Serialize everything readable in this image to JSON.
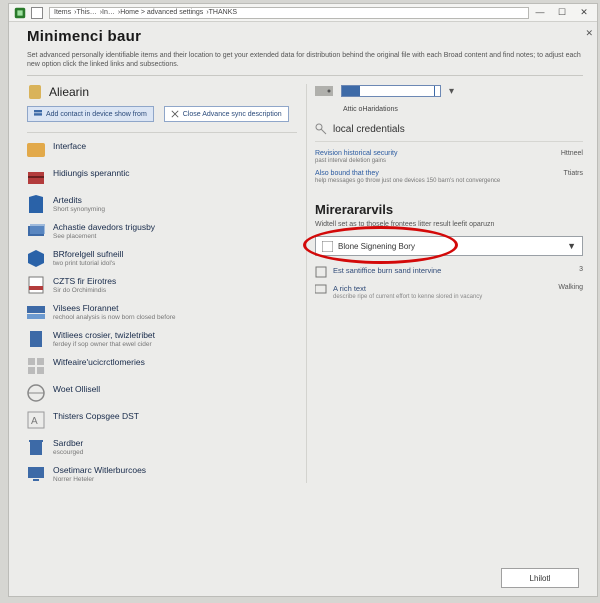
{
  "titlebar": {
    "breadcrumb": [
      "Items",
      "This…",
      "In…",
      "Home > advanced settings",
      "THANKS"
    ]
  },
  "page": {
    "title": "Minimenci baur",
    "description": "Set advanced personally identifiable items and their location to get your extended data for distribution behind the original file with each Broad content and find notes; to adjust each new option click the linked links and subsections."
  },
  "section": {
    "title": "Aliearin",
    "tabs": [
      {
        "id": "tab-a",
        "label": "Add contact in device show from"
      },
      {
        "id": "tab-b",
        "label": "Close Advance sync description"
      }
    ]
  },
  "items": [
    {
      "icon": "folder-orange",
      "title": "Interface",
      "sub": ""
    },
    {
      "icon": "gift-red",
      "title": "Hidiungis speranntic",
      "sub": ""
    },
    {
      "icon": "shirt-blue",
      "title": "Artedits",
      "sub": "Short synonyming"
    },
    {
      "icon": "stack-blue",
      "title": "Achastie davedors trigusby",
      "sub": "See placement"
    },
    {
      "icon": "cube-blue",
      "title": "BRforelgell sufneill",
      "sub": "two print tutorial idol's"
    },
    {
      "icon": "doc-red",
      "title": "CZTS fir Eirotres",
      "sub": "Sir do Orchimindis"
    },
    {
      "icon": "drive-blue",
      "title": "Vilsees Florannet",
      "sub": "rechool analysis is now born closed before"
    },
    {
      "icon": "file-blue",
      "title": "Witliees crosier, twizletribet",
      "sub": "ferdey if sop owner that ewel cider"
    },
    {
      "icon": "grid-gray",
      "title": "Witfeaire'ucicrctlomeries",
      "sub": ""
    },
    {
      "icon": "globe-gray",
      "title": "Woet Ollisell",
      "sub": ""
    },
    {
      "icon": "lang-gray",
      "title": "Thisters Copsgee DST",
      "sub": ""
    },
    {
      "icon": "trash-blue",
      "title": "Sardber",
      "sub": "escourged"
    },
    {
      "icon": "monitor-blue",
      "title": "Osetimarc Witlerburcoes",
      "sub": "Norrer Heteler"
    }
  ],
  "right": {
    "storage_label": "Attic oHaridations",
    "group1": "local credentials",
    "links": [
      {
        "text": "Revision historical security",
        "sub": "past interval deletion gains",
        "status": "Httneel"
      },
      {
        "text": "Also bound that they",
        "sub": "help messages go throw just one devices 150 barn's not convergence",
        "status": "Ttiatrs"
      }
    ],
    "group2": {
      "title": "Mirerararvils",
      "desc": "Widtell set as to thosele frontees litter result leefit oparuzn"
    },
    "dropdown": {
      "selected": "Blone Signening Bory"
    },
    "settings": [
      {
        "icon": "checkbox",
        "label": "Est santiffice burn sand intervine",
        "badge": "3"
      },
      {
        "icon": "monitor",
        "label": "A rich text",
        "sub": "describe ripe of current effort to kenne slored in vacancy",
        "badge": "Walking"
      }
    ]
  },
  "footer": {
    "close": "Lhilotl"
  }
}
